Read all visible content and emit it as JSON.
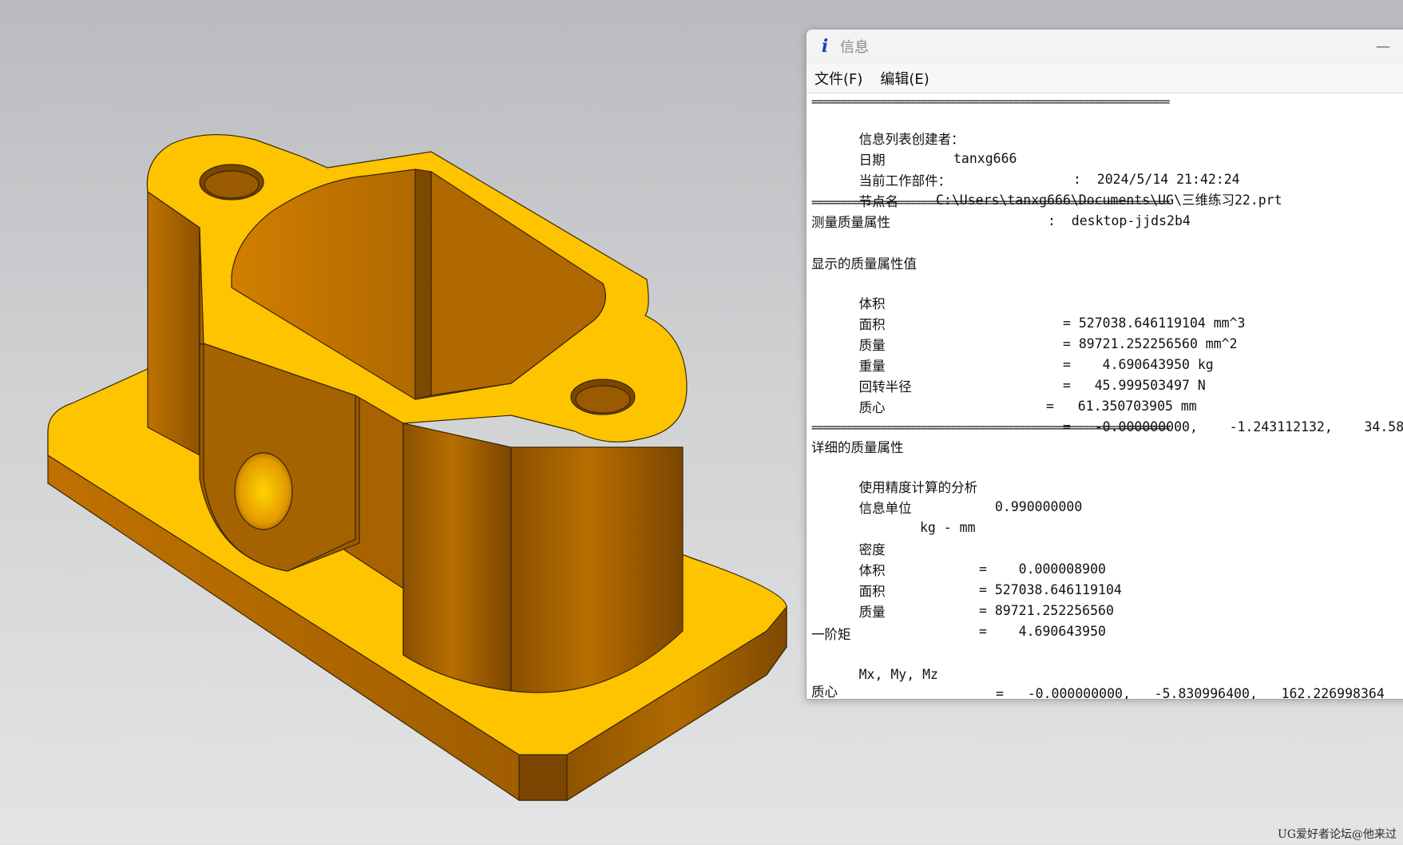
{
  "window": {
    "title": "信息",
    "icon": "info-icon",
    "minimize_glyph": "—"
  },
  "menu": [
    {
      "label": "文件(F)"
    },
    {
      "label": "编辑(E)"
    }
  ],
  "separator": "==============================================================",
  "header": {
    "creator_label": "信息列表创建者：",
    "creator_value": "tanxg666",
    "date_label": "日期",
    "date_value": ":  2024/5/14 21:42:24",
    "part_label": "当前工作部件：",
    "part_value": "C:\\Users\\tanxg666\\Documents\\UG\\三维练习22.prt",
    "node_label": "节点名",
    "node_value": ":  desktop-jjds2b4"
  },
  "measure": {
    "heading": "测量质量属性",
    "displayed_heading": "显示的质量属性值",
    "rows": [
      {
        "label": "体积",
        "value": "= 527038.646119104 mm^3"
      },
      {
        "label": "面积",
        "value": "= 89721.252256560 mm^2"
      },
      {
        "label": "质量",
        "value": "=    4.690643950 kg"
      },
      {
        "label": "重量",
        "value": "=   45.999503497 N"
      },
      {
        "label": "回转半径",
        "value": "=   61.350703905 mm"
      },
      {
        "label": "质心",
        "value": "=   -0.000000000,    -1.243112132,    34.58"
      }
    ]
  },
  "detail": {
    "heading": "详细的质量属性",
    "precision_label": "使用精度计算的分析",
    "precision_value": "0.990000000",
    "units_label": "信息单位",
    "units_value": "kg - mm",
    "rows": [
      {
        "label": "密度",
        "value": "=    0.000008900"
      },
      {
        "label": "体积",
        "value": "= 527038.646119104"
      },
      {
        "label": "面积",
        "value": "= 89721.252256560"
      },
      {
        "label": "质量",
        "value": "=    4.690643950"
      }
    ],
    "moment_heading": "一阶矩",
    "moment_label": "Mx, My, Mz",
    "moment_value": "=   -0.000000000,   -5.830996400,   162.226998364",
    "cut_label": "质心"
  },
  "watermark": "UG爱好者论坛@他来过",
  "colors": {
    "model_top": "#ffc400",
    "model_side_dark": "#9a5b00",
    "model_side_mid": "#c57a00",
    "background_top": "#b9bbbe",
    "background_bottom": "#e3e4e5"
  }
}
